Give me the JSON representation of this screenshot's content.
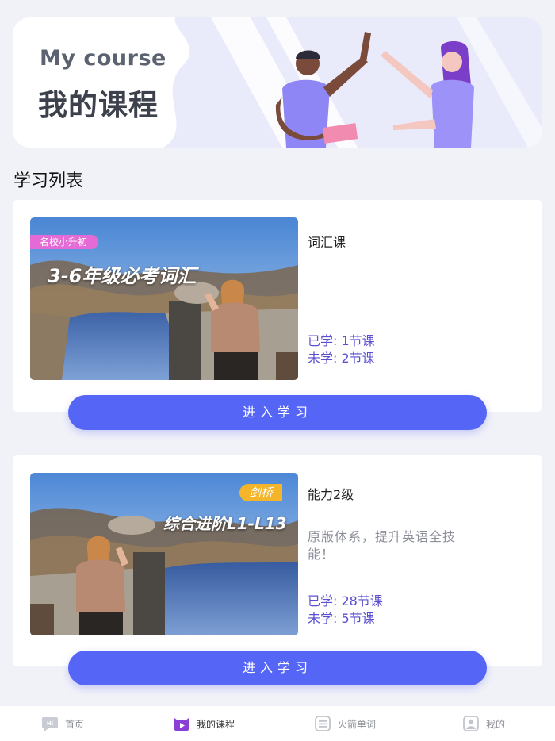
{
  "banner": {
    "title_en": "My course",
    "title_zh": "我的课程"
  },
  "section_title": "学习列表",
  "courses": [
    {
      "tag": "名校小升初",
      "overlay_title": "3-6年级必考词汇",
      "name": "词汇课",
      "description": "",
      "learned": "已学: 1节课",
      "unlearned": "未学: 2节课",
      "button": "进入学习"
    },
    {
      "tag": "剑桥",
      "overlay_title": "综合进阶L1-L13",
      "name": "能力2级",
      "description": "原版体系，提升英语全技能！",
      "learned": "已学: 28节课",
      "unlearned": "未学: 5节课",
      "button": "进入学习"
    }
  ],
  "tabbar": {
    "items": [
      {
        "label": "首页",
        "icon": "home-chat-icon",
        "active": false
      },
      {
        "label": "我的课程",
        "icon": "play-course-icon",
        "active": true
      },
      {
        "label": "火箭单词",
        "icon": "word-list-icon",
        "active": false
      },
      {
        "label": "我的",
        "icon": "profile-icon",
        "active": false
      }
    ]
  },
  "colors": {
    "accent": "#5565f5",
    "stat_text": "#5a4fd0",
    "tab_active": "#8a3fd6",
    "tag_pink": "#e46bd6",
    "tag_yellow": "#f4b52a"
  }
}
